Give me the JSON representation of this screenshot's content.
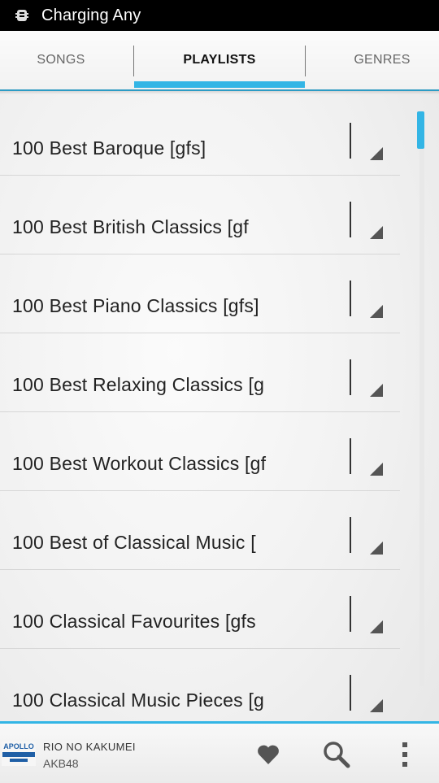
{
  "status_bar": {
    "icon": "usb-debug-icon",
    "text": "Charging Any"
  },
  "tabs": [
    {
      "label": "SONGS",
      "active": false
    },
    {
      "label": "PLAYLISTS",
      "active": true
    },
    {
      "label": "GENRES",
      "active": false
    }
  ],
  "playlists": [
    {
      "title": "100 Best Baroque [gfs]"
    },
    {
      "title": "100 Best British Classics [gf"
    },
    {
      "title": "100 Best Piano Classics [gfs]"
    },
    {
      "title": "100 Best Relaxing Classics [g"
    },
    {
      "title": "100 Best Workout Classics [gf"
    },
    {
      "title": "100 Best of Classical Music ["
    },
    {
      "title": "100 Classical Favourites [gfs"
    },
    {
      "title": "100 Classical Music Pieces [g"
    }
  ],
  "now_playing": {
    "album_art_text": "APOLLO",
    "title": "RIO NO KAKUMEI",
    "artist": "AKB48"
  },
  "actions": {
    "favorite_icon": "heart-icon",
    "search_icon": "search-icon",
    "overflow_icon": "overflow-menu-icon"
  },
  "colors": {
    "accent": "#33b5e5",
    "status_bar": "#000000"
  }
}
